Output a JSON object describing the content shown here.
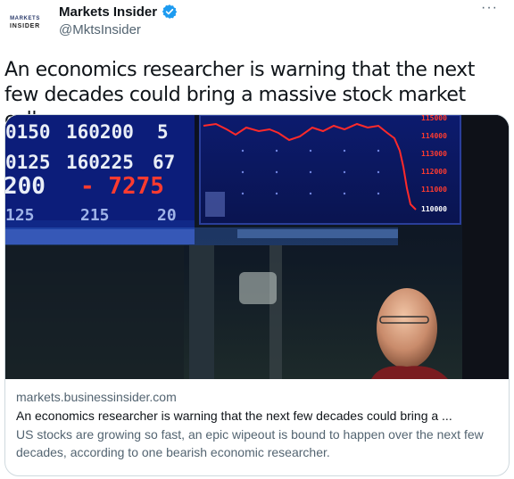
{
  "account": {
    "avatar_line1": "MARKETS",
    "avatar_line2": "INSIDER",
    "display_name": "Markets Insider",
    "handle": "@MktsInsider",
    "verified_icon": "verified-badge-icon",
    "more_label": "···"
  },
  "tweet": {
    "text": "An economics researcher is warning that the next few decades could bring a massive stock market collapse"
  },
  "card": {
    "domain": "markets.businessinsider.com",
    "title": "An economics researcher is warning that the next few decades could bring a ...",
    "description": "US stocks are growing so fast, an epic wipeout is bound to happen over the next few decades, according to one bearish economic researcher.",
    "image": {
      "board_rows": [
        [
          "0150",
          "160200",
          "5"
        ],
        [
          "0125",
          "160225",
          "67"
        ],
        [
          "200",
          "- 7275",
          ""
        ],
        [
          "125",
          "215",
          "20"
        ]
      ],
      "price_labels": [
        "115000",
        "114000",
        "113000",
        "112000",
        "111000",
        "110000"
      ]
    }
  },
  "colors": {
    "text_primary": "#0f1419",
    "text_secondary": "#536471",
    "border": "#cfd9de",
    "verified_blue": "#1d9bf0"
  }
}
